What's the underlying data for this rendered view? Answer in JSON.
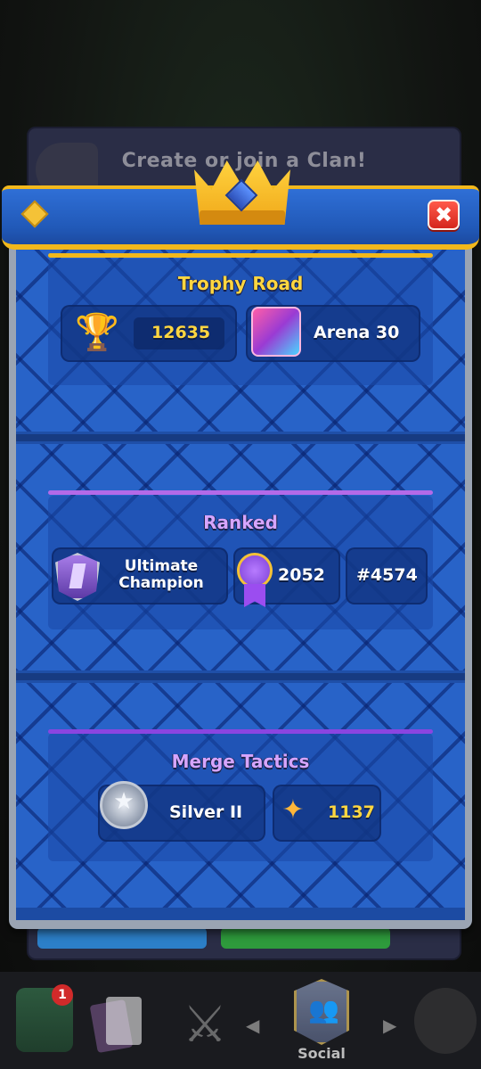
{
  "background": {
    "clan_title": "Create or join a Clan!"
  },
  "modal": {
    "close_label": "✖",
    "trophy_road": {
      "title": "Trophy Road",
      "trophies": "12635",
      "arena": "Arena 30",
      "accent_color": "#f2b81c"
    },
    "ranked": {
      "title": "Ranked",
      "league": "Ultimate\nChampion",
      "rating": "2052",
      "rank": "#4574",
      "accent_color": "#b36ae8"
    },
    "merge_tactics": {
      "title": "Merge Tactics",
      "league": "Silver II",
      "rating": "1137",
      "accent_color": "#8a45e0"
    }
  },
  "bottom_nav": {
    "shop_badge": "1",
    "social_label": "Social"
  },
  "icons": {
    "trophy": "trophy-icon",
    "arena": "arena-chest-icon",
    "rank": "ultimate-champion-badge-icon",
    "medal": "ranked-medal-icon",
    "silver": "silver-league-icon",
    "sparkle": "star-sparkle-icon"
  }
}
